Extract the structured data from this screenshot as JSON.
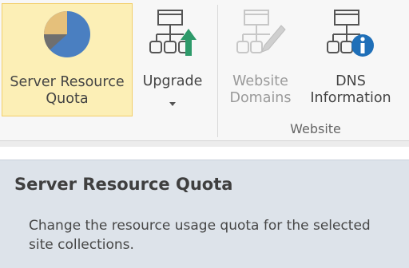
{
  "ribbon": {
    "buttons": [
      {
        "label": "Server Resource\nQuota",
        "icon": "pie-chart-icon",
        "state": "selected"
      },
      {
        "label": "Upgrade",
        "icon": "site-upgrade-icon",
        "state": "enabled",
        "has_dropdown": true
      },
      {
        "label": "Website\nDomains",
        "icon": "site-edit-icon",
        "state": "disabled"
      },
      {
        "label": "DNS\nInformation",
        "icon": "site-info-icon",
        "state": "enabled"
      }
    ],
    "groups": [
      {
        "label": "Website"
      }
    ]
  },
  "tooltip": {
    "title": "Server Resource Quota",
    "description": "Change the resource usage quota for the selected site collections."
  },
  "colors": {
    "selected_bg": "#fcefb6",
    "selected_border": "#f2cf6a",
    "pie_blue": "#4a7fc1",
    "pie_tan": "#e5c07b",
    "pie_gray": "#6f6f6f",
    "arrow_green": "#2e9a6a",
    "info_blue": "#1f6fb8",
    "tooltip_bg": "#dde3ea"
  }
}
